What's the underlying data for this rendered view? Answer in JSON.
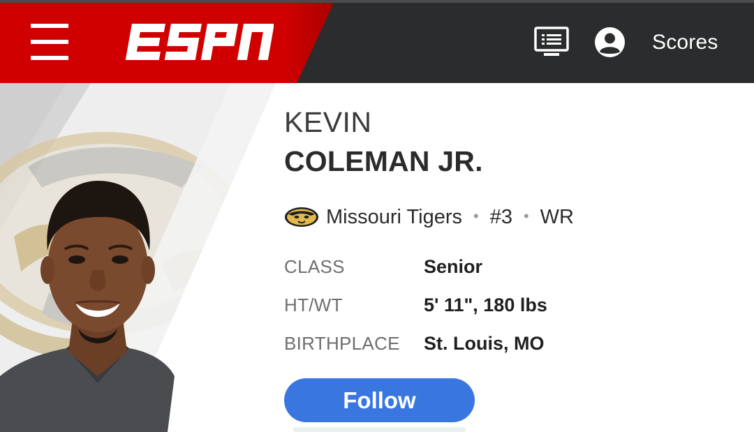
{
  "header": {
    "logo_text": "ESPN",
    "scores_label": "Scores",
    "icons": [
      "menu-icon",
      "watch-tv-icon",
      "user-icon"
    ],
    "colors": {
      "brand_red": "#d00000",
      "header_bg": "#2b2c2d"
    }
  },
  "player": {
    "first_name": "KEVIN",
    "last_name": "COLEMAN JR.",
    "team": "Missouri Tigers",
    "number": "#3",
    "position": "WR",
    "separator": "•",
    "bio": [
      {
        "label": "CLASS",
        "value": "Senior"
      },
      {
        "label": "HT/WT",
        "value": "5' 11\", 180 lbs"
      },
      {
        "label": "BIRTHPLACE",
        "value": "St. Louis, MO"
      }
    ]
  },
  "actions": {
    "follow_label": "Follow",
    "follow_color": "#3a76e0"
  }
}
